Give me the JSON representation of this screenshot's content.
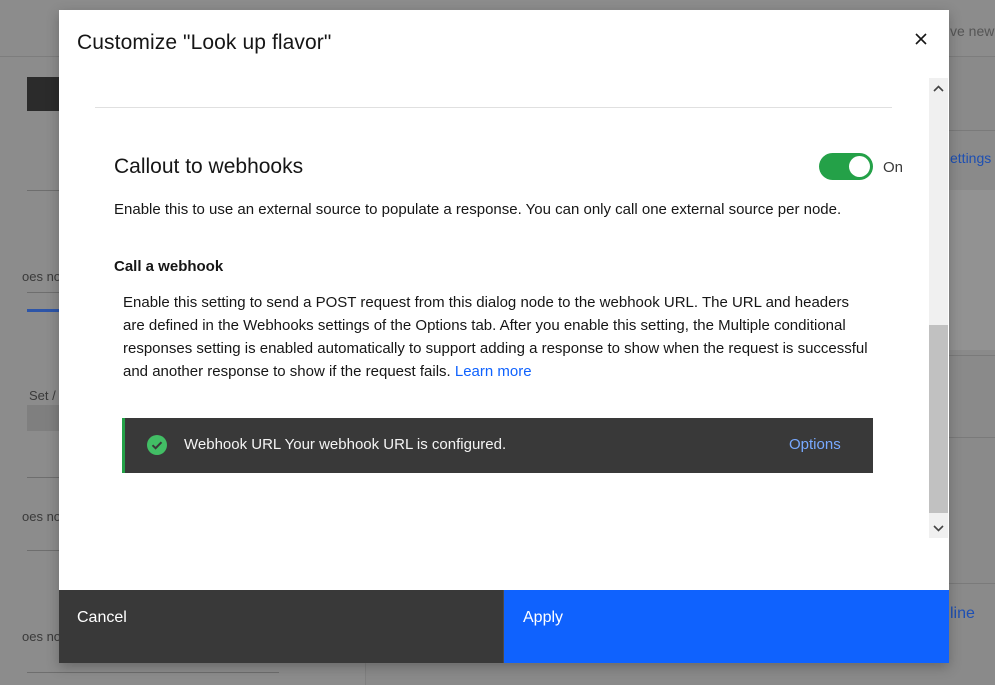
{
  "background": {
    "fragments": {
      "top_right": "ve new",
      "settings": "ettings",
      "left_row1": "oes no",
      "left_set": "Set /",
      "left_row2": "oes no",
      "left_row3": "oes no",
      "line_link": "line"
    }
  },
  "modal": {
    "title": "Customize \"Look up flavor\"",
    "section": {
      "title": "Callout to webhooks",
      "toggle_state": "On",
      "description": "Enable this to use an external source to populate a response. You can only call one external source per node.",
      "subheading": "Call a webhook",
      "paragraph": "Enable this setting to send a POST request from this dialog node to the webhook URL. The URL and headers are defined in the Webhooks settings of the Options tab. After you enable this setting, the Multiple conditional responses setting is enabled automatically to support adding a response to show when the request is successful and another response to show if the request fails.",
      "learn_more": "Learn more"
    },
    "notification": {
      "text": "Webhook URL Your webhook URL is configured.",
      "action": "Options",
      "accent": "#24a148"
    },
    "footer": {
      "cancel": "Cancel",
      "apply": "Apply"
    }
  },
  "colors": {
    "primary": "#0f62fe",
    "success": "#24a148",
    "dark": "#393939"
  }
}
